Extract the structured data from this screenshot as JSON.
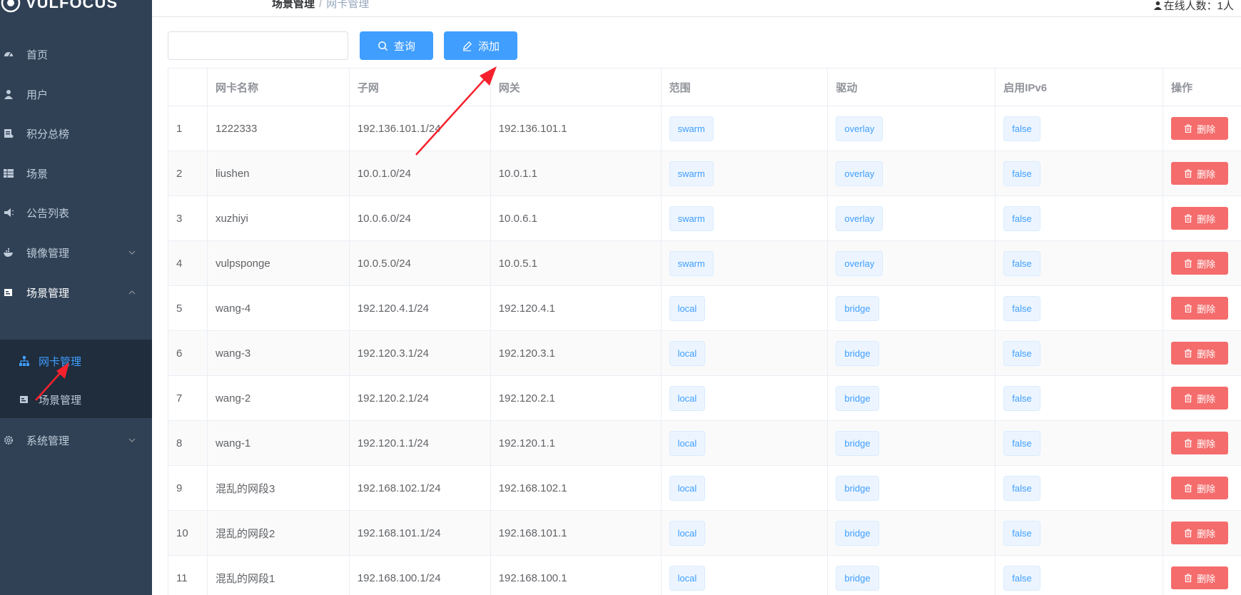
{
  "app": {
    "logo_text": "VULFOCUS"
  },
  "topbar": {
    "breadcrumb_parent": "场景管理",
    "breadcrumb_current": "网卡管理",
    "online_count": "在线人数：1人"
  },
  "sidebar": {
    "items": [
      {
        "label": "首页",
        "icon": "dashboard-icon"
      },
      {
        "label": "用户",
        "icon": "user-icon"
      },
      {
        "label": "积分总榜",
        "icon": "ranking-icon"
      },
      {
        "label": "场景",
        "icon": "grid-icon"
      },
      {
        "label": "公告列表",
        "icon": "megaphone-icon"
      },
      {
        "label": "镜像管理",
        "icon": "docker-icon"
      },
      {
        "label": "场景管理",
        "icon": "scene-icon"
      },
      {
        "label": "系统管理",
        "icon": "gear-icon"
      }
    ],
    "submenu": [
      {
        "label": "网卡管理",
        "icon": "network-icon",
        "active": true
      },
      {
        "label": "场景管理",
        "icon": "scene-icon",
        "active": false
      }
    ]
  },
  "toolbar": {
    "search_value": "",
    "search_label": "查询",
    "add_label": "添加"
  },
  "table": {
    "headers": [
      "",
      "网卡名称",
      "子网",
      "网关",
      "范围",
      "驱动",
      "启用IPv6",
      "操作"
    ],
    "delete_label": "删除",
    "rows": [
      {
        "index": "1",
        "name": "1222333",
        "subnet": "192.136.101.1/24",
        "gateway": "192.136.101.1",
        "scope": "swarm",
        "driver": "overlay",
        "ipv6": "false"
      },
      {
        "index": "2",
        "name": "liushen",
        "subnet": "10.0.1.0/24",
        "gateway": "10.0.1.1",
        "scope": "swarm",
        "driver": "overlay",
        "ipv6": "false"
      },
      {
        "index": "3",
        "name": "xuzhiyi",
        "subnet": "10.0.6.0/24",
        "gateway": "10.0.6.1",
        "scope": "swarm",
        "driver": "overlay",
        "ipv6": "false"
      },
      {
        "index": "4",
        "name": "vulpsponge",
        "subnet": "10.0.5.0/24",
        "gateway": "10.0.5.1",
        "scope": "swarm",
        "driver": "overlay",
        "ipv6": "false"
      },
      {
        "index": "5",
        "name": "wang-4",
        "subnet": "192.120.4.1/24",
        "gateway": "192.120.4.1",
        "scope": "local",
        "driver": "bridge",
        "ipv6": "false"
      },
      {
        "index": "6",
        "name": "wang-3",
        "subnet": "192.120.3.1/24",
        "gateway": "192.120.3.1",
        "scope": "local",
        "driver": "bridge",
        "ipv6": "false"
      },
      {
        "index": "7",
        "name": "wang-2",
        "subnet": "192.120.2.1/24",
        "gateway": "192.120.2.1",
        "scope": "local",
        "driver": "bridge",
        "ipv6": "false"
      },
      {
        "index": "8",
        "name": "wang-1",
        "subnet": "192.120.1.1/24",
        "gateway": "192.120.1.1",
        "scope": "local",
        "driver": "bridge",
        "ipv6": "false"
      },
      {
        "index": "9",
        "name": "混乱的网段3",
        "subnet": "192.168.102.1/24",
        "gateway": "192.168.102.1",
        "scope": "local",
        "driver": "bridge",
        "ipv6": "false"
      },
      {
        "index": "10",
        "name": "混乱的网段2",
        "subnet": "192.168.101.1/24",
        "gateway": "192.168.101.1",
        "scope": "local",
        "driver": "bridge",
        "ipv6": "false"
      },
      {
        "index": "11",
        "name": "混乱的网段1",
        "subnet": "192.168.100.1/24",
        "gateway": "192.168.100.1",
        "scope": "local",
        "driver": "bridge",
        "ipv6": "false"
      }
    ]
  },
  "colors": {
    "sidebar_bg": "#304156",
    "submenu_bg": "#1f2d3d",
    "primary": "#409eff",
    "danger": "#f56c6c",
    "annotation": "#f5222d"
  }
}
